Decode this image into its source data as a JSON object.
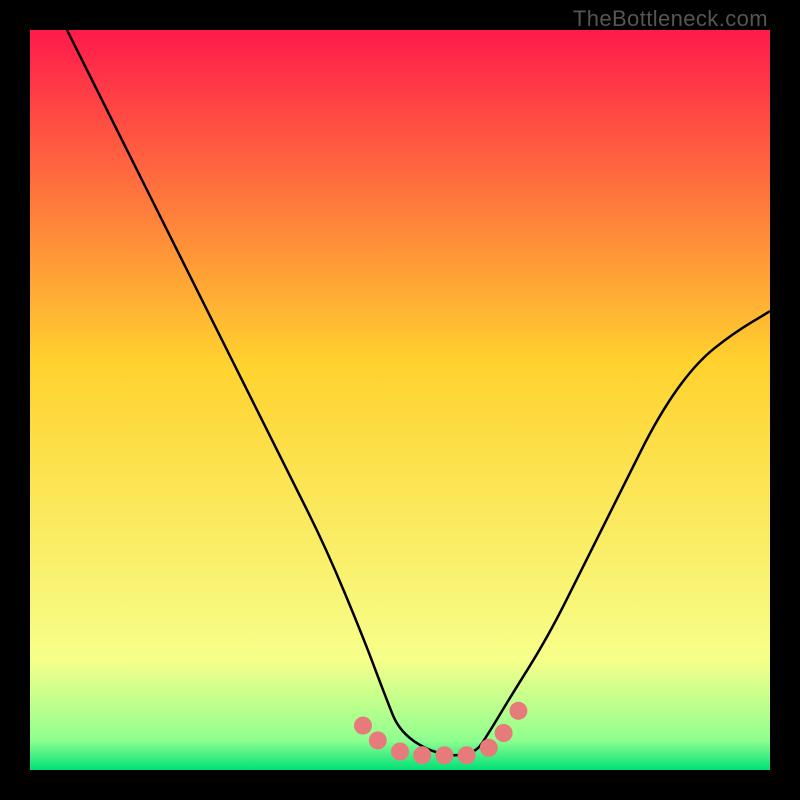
{
  "watermark": "TheBottleneck.com",
  "chart_data": {
    "type": "line",
    "title": "",
    "xlabel": "",
    "ylabel": "",
    "xlim": [
      0,
      100
    ],
    "ylim": [
      0,
      100
    ],
    "grid": false,
    "legend": "none",
    "background_gradient": {
      "0.0": "#ff1a4b",
      "0.45": "#ffd22e",
      "0.85": "#f7ff8a",
      "0.96": "#8fff8f",
      "1.0": "#00e077"
    },
    "series": [
      {
        "name": "curve",
        "color": "#000000",
        "x": [
          5,
          10,
          15,
          20,
          25,
          30,
          35,
          40,
          45,
          48,
          50,
          55,
          60,
          62,
          65,
          70,
          75,
          80,
          85,
          90,
          95,
          100
        ],
        "y": [
          100,
          90,
          80,
          70,
          60,
          50,
          40,
          30,
          18,
          10,
          5,
          2,
          2,
          5,
          10,
          18,
          28,
          38,
          48,
          55,
          59,
          62
        ]
      },
      {
        "name": "highlight-dots",
        "color": "#e77a7a",
        "x": [
          45,
          47,
          50,
          53,
          56,
          59,
          62,
          64,
          66
        ],
        "y": [
          6,
          4,
          2.5,
          2,
          2,
          2,
          3,
          5,
          8
        ]
      }
    ]
  }
}
